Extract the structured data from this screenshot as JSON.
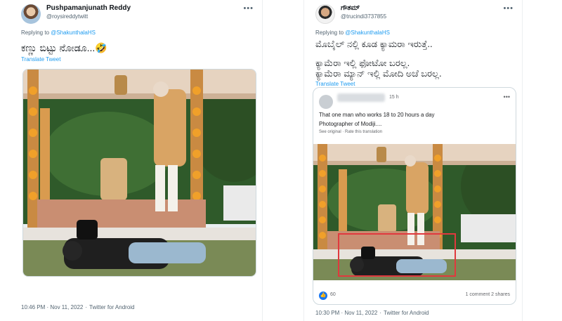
{
  "left_tweet": {
    "display_name": "Pushpamanjunath Reddy",
    "handle": "@roysireddytwitt",
    "replying_prefix": "Replying to",
    "replying_to": "@ShakunthalaHS",
    "text": "ಕಣ್ಣು ಬಿಟ್ಟು ನೋಡೂ...🤣",
    "translate_label": "Translate Tweet",
    "timestamp": "10:46 PM · Nov 11, 2022",
    "source": "Twitter for Android"
  },
  "right_tweet": {
    "display_name": "ಗೌತಮ್",
    "handle": "@trucindi3737855",
    "replying_prefix": "Replying to",
    "replying_to": "@ShakunthalaHS",
    "line1": "ಮೊಬೈಲ್ ನಲ್ಲಿ ಕೂಡ ಕ್ಯಾಮರಾ ಇರುತ್ತೆ..",
    "line2": "ಕ್ಯಾಮೆರಾ ಇಲ್ಲಿ ಫೋಟೋ ಬರಲ್ಲ.",
    "line3": "ಕ್ಯಾಮೆರಾ ಮ್ಯಾನ್ ಇಲ್ಲಿ ಮೋದಿ ಅಚೆ ಬರಲ್ಲ.",
    "translate_label": "Translate Tweet",
    "timestamp": "10:30 PM · Nov 11, 2022",
    "source": "Twitter for Android",
    "quoted_post": {
      "time": "15 h",
      "text_line1": "That one man who works 18 to 20 hours a day",
      "text_line2": "Photographer of Modiji....",
      "see_original": "See original · Rate this translation",
      "likes": "60",
      "comments": "1 comment  2 shares"
    }
  },
  "icons": {
    "more": "more-icon",
    "like": "like-icon"
  },
  "colors": {
    "link_blue": "#1d9bf0",
    "highlight_red": "#e0393e"
  }
}
